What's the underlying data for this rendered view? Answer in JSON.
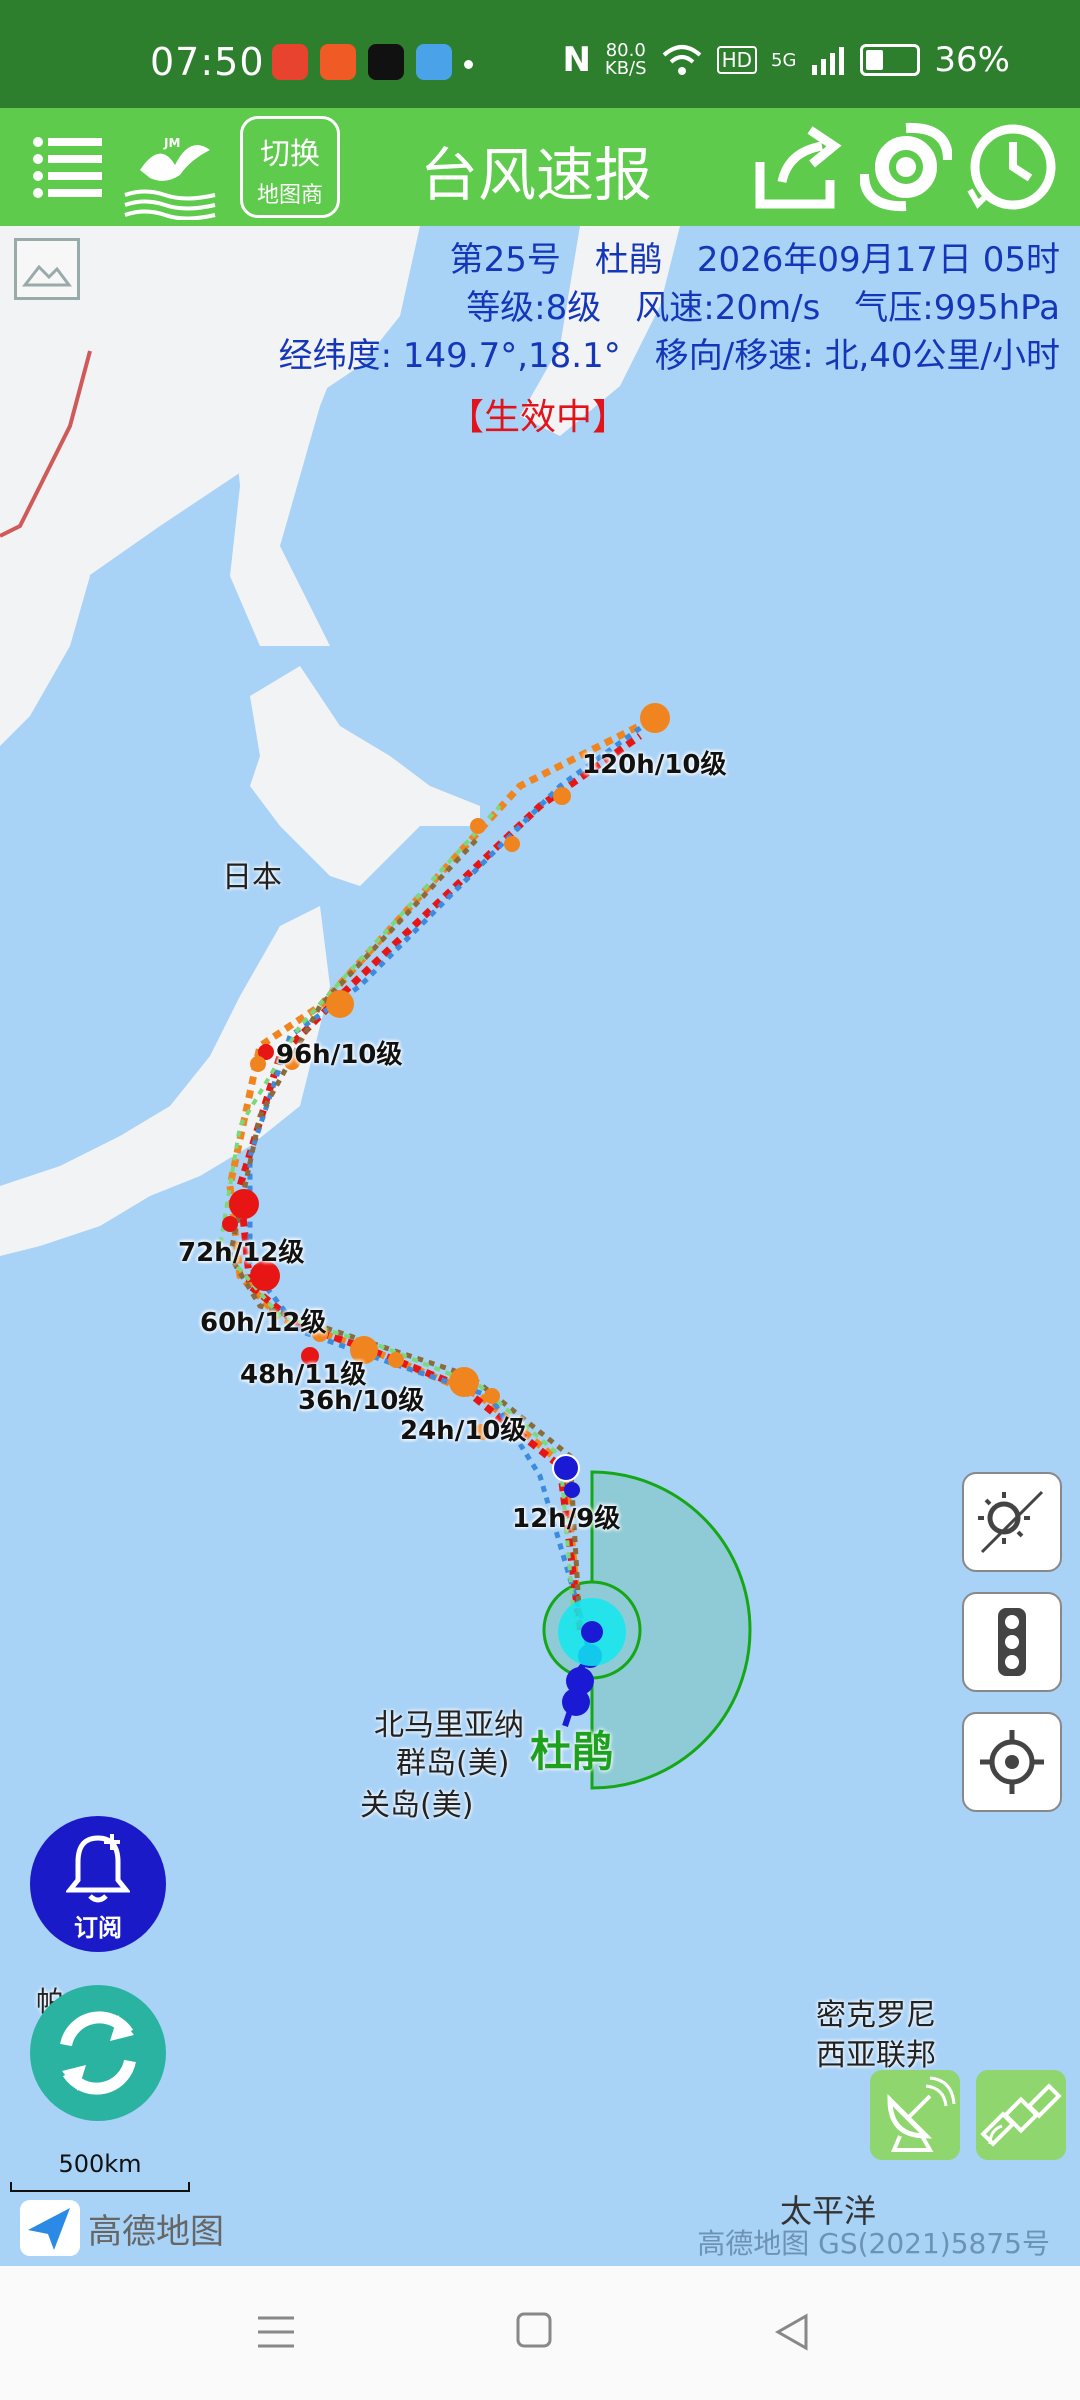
{
  "status_bar": {
    "time": "07:50",
    "net_speed_value": "80.0",
    "net_speed_unit": "KB/S",
    "hd": "HD",
    "five_g": "5G",
    "battery": "36%"
  },
  "app_bar": {
    "switch_line1": "切换",
    "switch_line2": "地图商",
    "logo_text": "JM",
    "title": "台风速报"
  },
  "typhoon": {
    "line1": "第25号　杜鹃　2026年09月17日 05时",
    "line2": "等级:8级　风速:20m/s　气压:995hPa",
    "line3": "经纬度:  149.7°,18.1°　移向/移速:  北,40公里/小时",
    "status": "【生效中】",
    "name_on_map": "杜鹃"
  },
  "forecast_labels": [
    "120h/10级",
    "96h/10级",
    "72h/12级",
    "60h/12级",
    "48h/11级",
    "36h/10级",
    "24h/10级",
    "12h/9级"
  ],
  "places": {
    "japan": "日本",
    "mariana": "北马里亚纳",
    "mariana2": "群岛(美)",
    "guam": "关岛(美)",
    "micronesia1": "密克罗尼",
    "micronesia2": "西亚联邦",
    "pacific": "太平洋",
    "partial": "帕"
  },
  "controls": {
    "subscribe": "订阅",
    "scale": "500km",
    "amap": "高德地图",
    "copyright": "高德地图 GS(2021)5875号"
  },
  "colors": {
    "accent_green": "#5ecb4c",
    "status_green": "#2d7f2d",
    "info_blue": "#1436b8",
    "status_red": "#e1141c"
  }
}
